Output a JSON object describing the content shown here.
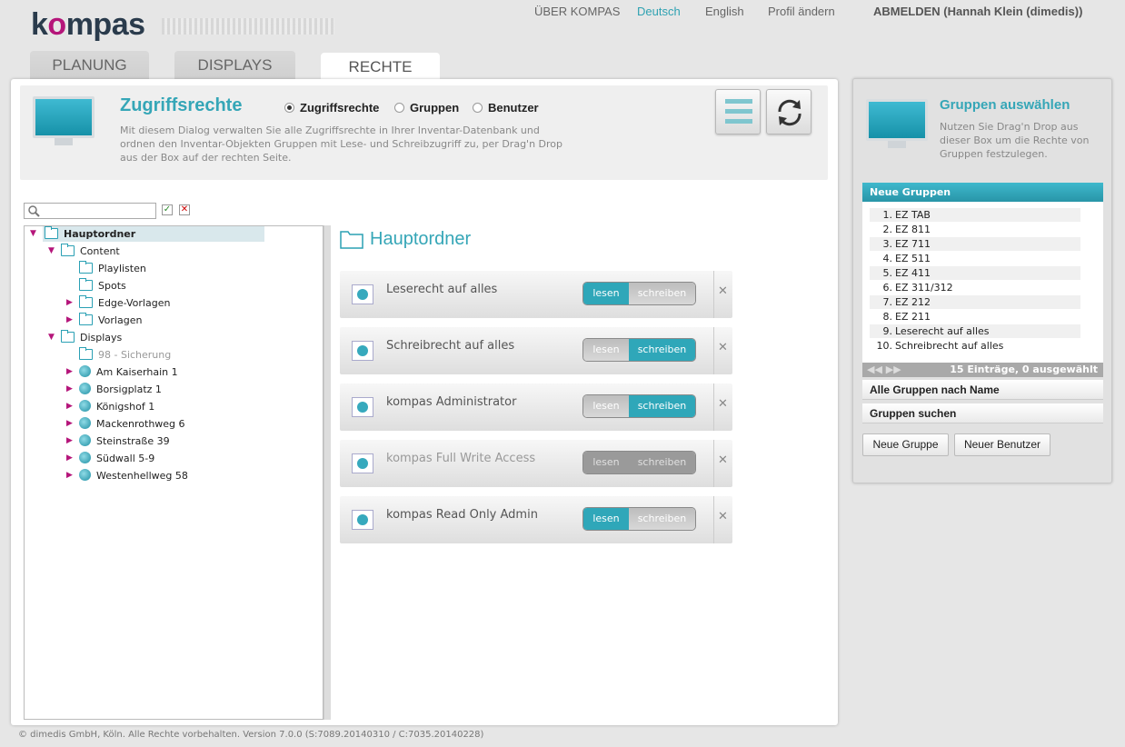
{
  "header": {
    "logo_text": "kompas",
    "nav": {
      "about": "ÜBER KOMPAS",
      "lang_de": "Deutsch",
      "lang_en": "English",
      "profile": "Profil ändern",
      "logout": "ABMELDEN (Hannah Klein (dimedis))"
    }
  },
  "tabs": [
    "PLANUNG",
    "DISPLAYS",
    "RECHTE"
  ],
  "active_tab": "RECHTE",
  "main_header": {
    "title": "Zugriffsrechte",
    "radio_options": [
      "Zugriffsrechte",
      "Gruppen",
      "Benutzer"
    ],
    "radio_selected": "Zugriffsrechte",
    "description": "Mit diesem Dialog verwalten Sie alle Zugriffsrechte in Ihrer Inventar-Datenbank und ordnen den Inventar-Objekten Gruppen mit Lese- und Schreibzugriff zu, per Drag'n Drop aus der Box auf der rechten Seite."
  },
  "search": {
    "value": "",
    "placeholder": ""
  },
  "tree": {
    "root": "Hauptordner",
    "content": "Content",
    "playlisten": "Playlisten",
    "spots": "Spots",
    "edge": "Edge-Vorlagen",
    "vorlagen": "Vorlagen",
    "displays": "Displays",
    "sicherung": "98 - Sicherung",
    "kaiserhain": "Am Kaiserhain 1",
    "borsig": "Borsigplatz 1",
    "koenigshof": "Königshof 1",
    "mackenroth": "Mackenrothweg 6",
    "steinstrasse": "Steinstraße 39",
    "suedwall": "Südwall 5-9",
    "westenhellweg": "Westenhellweg 58"
  },
  "folder_title": "Hauptordner",
  "permission_rows": [
    {
      "label": "Leserecht auf alles",
      "read": true,
      "write": false
    },
    {
      "label": "Schreibrecht auf alles",
      "read": false,
      "write": true
    },
    {
      "label": "kompas Administrator",
      "read": false,
      "write": true
    },
    {
      "label": "kompas Full Write Access",
      "read": false,
      "write": false
    },
    {
      "label": "kompas Read Only Admin",
      "read": true,
      "write": false
    }
  ],
  "toggle_labels": {
    "read": "lesen",
    "write": "schreiben"
  },
  "side_panel": {
    "title": "Gruppen auswählen",
    "description": "Nutzen Sie Drag'n Drop aus dieser Box um die Rechte von Gruppen festzulegen.",
    "new_groups_header": "Neue Gruppen",
    "groups": [
      {
        "n": "1.",
        "name": "EZ TAB"
      },
      {
        "n": "2.",
        "name": "EZ 811"
      },
      {
        "n": "3.",
        "name": "EZ 711"
      },
      {
        "n": "4.",
        "name": "EZ 511"
      },
      {
        "n": "5.",
        "name": "EZ 411"
      },
      {
        "n": "6.",
        "name": "EZ 311/312"
      },
      {
        "n": "7.",
        "name": "EZ 212"
      },
      {
        "n": "8.",
        "name": "EZ 211"
      },
      {
        "n": "9.",
        "name": "Leserecht auf alles"
      },
      {
        "n": "10.",
        "name": "Schreibrecht auf alles"
      }
    ],
    "pager_info": "15 Einträge, 0 ausgewählt",
    "all_groups": "Alle Gruppen nach Name",
    "search_groups": "Gruppen suchen",
    "new_group_button": "Neue Gruppe",
    "new_user_button": "Neuer Benutzer"
  },
  "footer": "© dimedis GmbH, Köln. Alle Rechte vorbehalten. Version 7.0.0 (S:7089.20140310 / C:7035.20140228)",
  "colors": {
    "accent": "#2fa7b9",
    "tree_arrow": "#b5157a",
    "title": "#35a6b7"
  }
}
